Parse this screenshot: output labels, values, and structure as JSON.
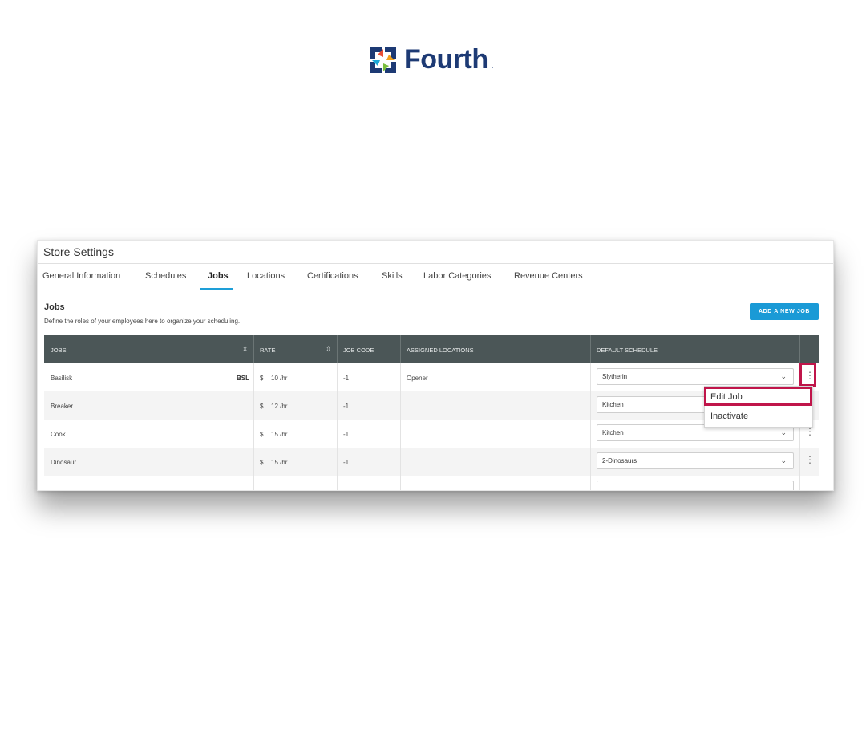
{
  "brand": {
    "name": "Fourth",
    "trademark": "."
  },
  "header": {
    "title": "Store Settings"
  },
  "tabs": [
    {
      "label": "General Information"
    },
    {
      "label": "Schedules"
    },
    {
      "label": "Jobs",
      "active": true
    },
    {
      "label": "Locations"
    },
    {
      "label": "Certifications"
    },
    {
      "label": "Skills"
    },
    {
      "label": "Labor Categories"
    },
    {
      "label": "Revenue Centers"
    }
  ],
  "section": {
    "title": "Jobs",
    "description": "Define the roles of your employees here to organize your scheduling.",
    "add_button": "ADD A NEW JOB"
  },
  "table": {
    "columns": [
      "JOBS",
      "RATE",
      "JOB CODE",
      "ASSIGNED LOCATIONS",
      "DEFAULT SCHEDULE"
    ],
    "rows": [
      {
        "job": "Basilisk",
        "badge": "BSL",
        "currency": "$",
        "rate": "10 /hr",
        "job_code": "-1",
        "locations": "Opener",
        "schedule": "Slytherin"
      },
      {
        "job": "Breaker",
        "badge": "",
        "currency": "$",
        "rate": "12 /hr",
        "job_code": "-1",
        "locations": "",
        "schedule": "Kitchen"
      },
      {
        "job": "Cook",
        "badge": "",
        "currency": "$",
        "rate": "15 /hr",
        "job_code": "-1",
        "locations": "",
        "schedule": "Kitchen"
      },
      {
        "job": "Dinosaur",
        "badge": "",
        "currency": "$",
        "rate": "15 /hr",
        "job_code": "-1",
        "locations": "",
        "schedule": "2-Dinosaurs"
      }
    ]
  },
  "context_menu": {
    "items": [
      "Edit Job",
      "Inactivate"
    ]
  },
  "colors": {
    "accent": "#1a9ad6",
    "highlight": "#c0154a",
    "header_bg": "#4b5657",
    "brand": "#1d3a74"
  }
}
